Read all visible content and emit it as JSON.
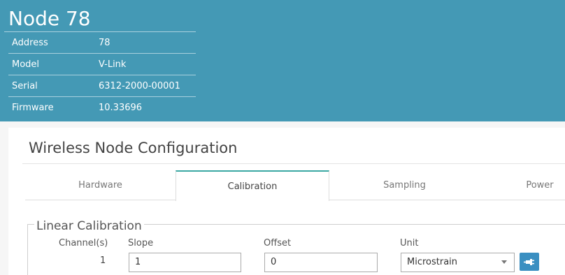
{
  "node": {
    "title": "Node 78",
    "info": [
      {
        "label": "Address",
        "value": "78"
      },
      {
        "label": "Model",
        "value": "V-Link"
      },
      {
        "label": "Serial",
        "value": "6312-2000-00001"
      },
      {
        "label": "Firmware",
        "value": "10.33696"
      }
    ]
  },
  "config": {
    "title": "Wireless Node Configuration",
    "tabs": [
      {
        "label": "Hardware"
      },
      {
        "label": "Calibration",
        "active": true
      },
      {
        "label": "Sampling"
      },
      {
        "label": "Power"
      }
    ]
  },
  "calibration": {
    "legend": "Linear Calibration",
    "headers": {
      "channels": "Channel(s)",
      "slope": "Slope",
      "offset": "Offset",
      "unit": "Unit"
    },
    "row": {
      "channel": "1",
      "slope": "1",
      "offset": "0",
      "unit": "Microstrain"
    }
  },
  "colors": {
    "header": "#4499b5",
    "active_tab": "#3aa8a3",
    "button": "#3a8fc1"
  },
  "icons": {
    "apply": "plug-icon",
    "dropdown": "chevron-down-icon"
  }
}
